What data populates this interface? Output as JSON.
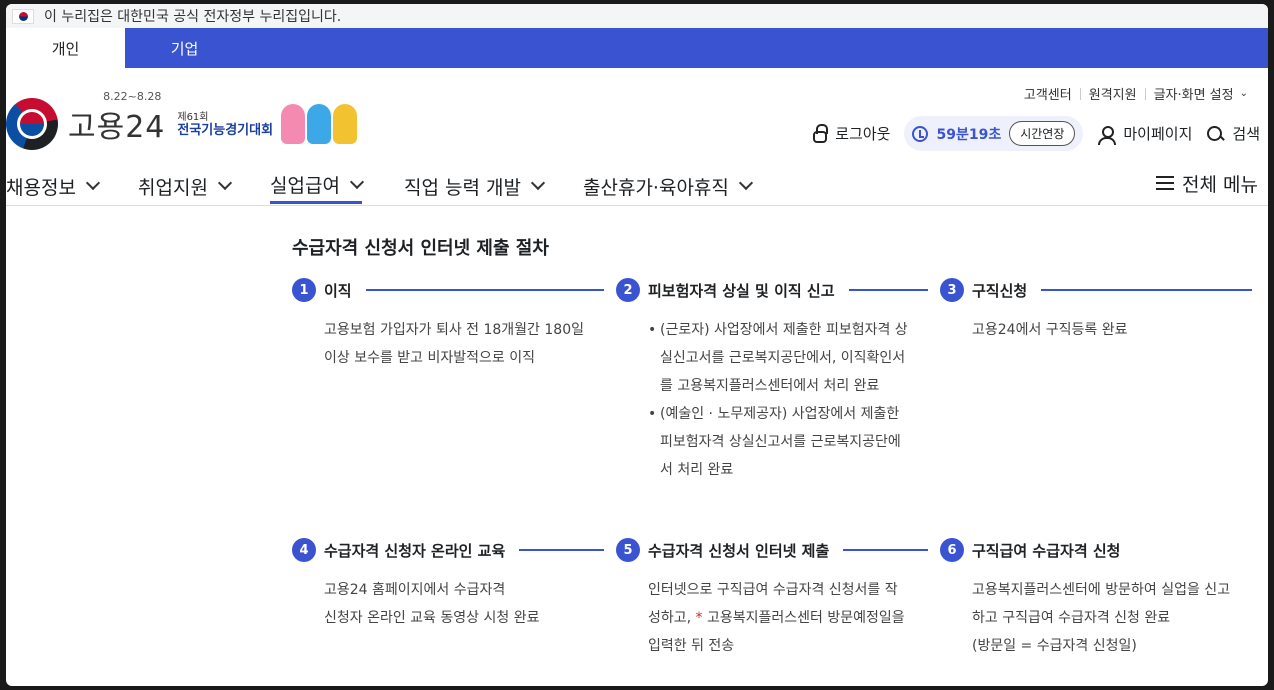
{
  "gov_banner": {
    "text": "이 누리집은 대한민국 공식 전자정부 누리집입니다."
  },
  "audience_tabs": [
    {
      "label": "개인"
    },
    {
      "label": "기업"
    }
  ],
  "utility_links": {
    "customer_center": "고객센터",
    "remote_support": "원격지원",
    "text_screen_settings": "글자·화면 설정"
  },
  "header": {
    "brand": "고용24",
    "event_dates": "8.22~8.28",
    "event_round": "제61회",
    "event_name": "전국기능경기대회",
    "logout_label": "로그아웃",
    "timer_value": "59분19초",
    "extend_label": "시간연장",
    "mypage_label": "마이페이지",
    "search_label": "검색"
  },
  "nav": {
    "items": [
      {
        "label": "채용정보"
      },
      {
        "label": "취업지원"
      },
      {
        "label": "실업급여"
      },
      {
        "label": "직업 능력 개발"
      },
      {
        "label": "출산휴가·육아휴직"
      }
    ],
    "all_menu": "전체 메뉴"
  },
  "content": {
    "title": "수급자격 신청서 인터넷 제출 절차",
    "steps": [
      {
        "number": "1",
        "title": "이직",
        "lines": [
          "고용보험 가입자가 퇴사 전 18개월간 180일",
          "이상 보수를 받고 비자발적으로 이직"
        ]
      },
      {
        "number": "2",
        "title": "피보험자격 상실 및 이직 신고",
        "bullets": [
          [
            "(근로자) 사업장에서 제출한 피보험자격 상",
            "실신고서를 근로복지공단에서, 이직확인서",
            "를 고용복지플러스센터에서 처리 완료"
          ],
          [
            "(예술인 · 노무제공자) 사업장에서 제출한",
            "피보험자격 상실신고서를 근로복지공단에",
            "서 처리 완료"
          ]
        ]
      },
      {
        "number": "3",
        "title": "구직신청",
        "lines": [
          "고용24에서 구직등록 완료"
        ]
      },
      {
        "number": "4",
        "title": "수급자격 신청자 온라인 교육",
        "lines": [
          "고용24 홈페이지에서 수급자격",
          "신청자 온라인 교육 동영상 시청 완료"
        ]
      },
      {
        "number": "5",
        "title": "수급자격 신청서 인터넷 제출",
        "line1": "인터넷으로 구직급여 수급자격 신청서를 작",
        "line2_pre": "성하고, ",
        "line2_mark": "*",
        "line2_post": " 고용복지플러스센터 방문예정일을",
        "line3": "입력한 뒤 전송"
      },
      {
        "number": "6",
        "title": "구직급여 수급자격 신청",
        "lines": [
          "고용복지플러스센터에 방문하여 실업을 신고",
          "하고 구직급여 수급자격 신청 완료",
          "(방문일 = 수급자격 신청일)"
        ]
      }
    ]
  }
}
